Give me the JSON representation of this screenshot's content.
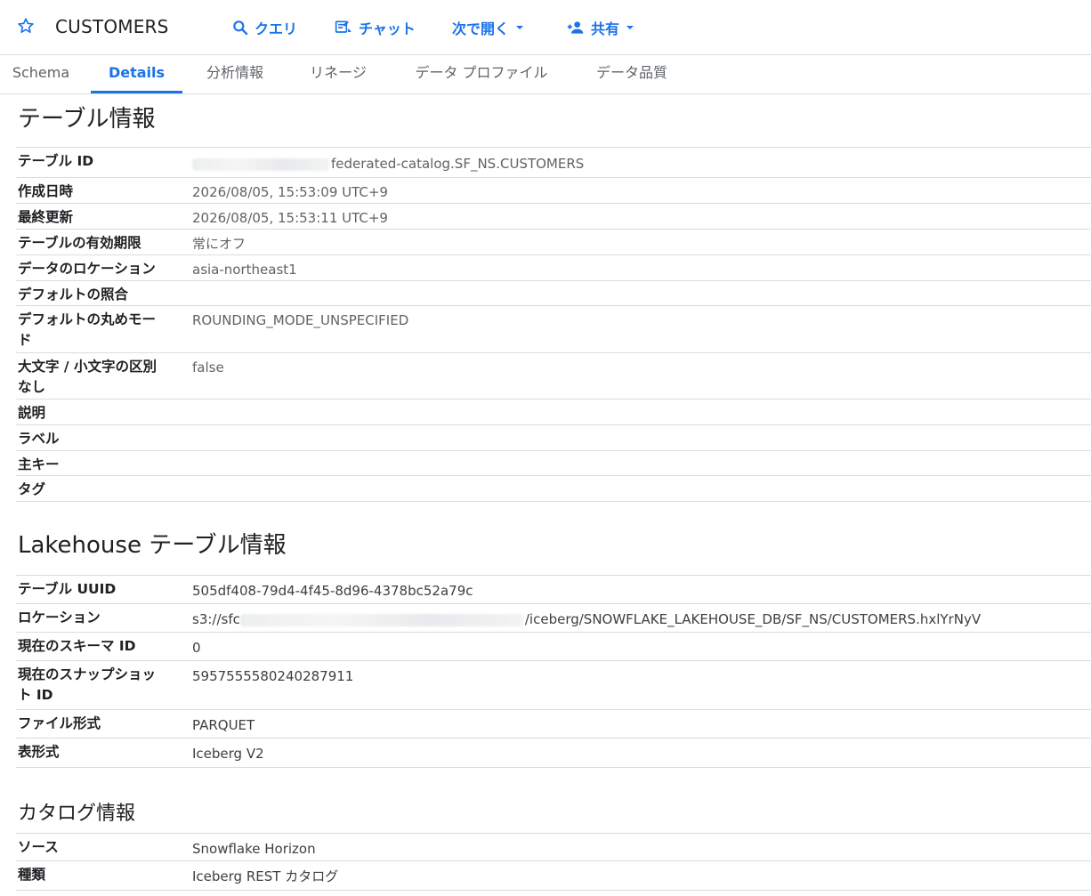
{
  "header": {
    "title": "CUSTOMERS",
    "buttons": {
      "query": "クエリ",
      "chat": "チャット",
      "open_with": "次で開く",
      "share": "共有"
    }
  },
  "tabs": [
    {
      "label": "Schema"
    },
    {
      "label": "Details"
    },
    {
      "label": "分析情報"
    },
    {
      "label": "リネージ"
    },
    {
      "label": "データ プロファイル"
    },
    {
      "label": "データ品質"
    }
  ],
  "active_tab": "Details",
  "table_info": {
    "title": "テーブル情報",
    "rows": [
      {
        "key": "テーブル ID",
        "value": "federated-catalog.SF_NS.CUSTOMERS"
      },
      {
        "key": "作成日時",
        "value": "2026/08/05, 15:53:09 UTC+9"
      },
      {
        "key": "最終更新",
        "value": "2026/08/05, 15:53:11 UTC+9"
      },
      {
        "key": "テーブルの有効期限",
        "value": "常にオフ"
      },
      {
        "key": "データのロケーション",
        "value": "asia-northeast1"
      },
      {
        "key": "デフォルトの照合",
        "value": ""
      },
      {
        "key": "デフォルトの丸めモード",
        "value": "ROUNDING_MODE_UNSPECIFIED"
      },
      {
        "key": "大文字 / 小文字の区別なし",
        "value": "false"
      },
      {
        "key": "説明",
        "value": ""
      },
      {
        "key": "ラベル",
        "value": ""
      },
      {
        "key": "主キー",
        "value": ""
      },
      {
        "key": "タグ",
        "value": ""
      }
    ]
  },
  "lakehouse_info": {
    "title": "Lakehouse テーブル情報",
    "rows": [
      {
        "key": "テーブル UUID",
        "value": "505df408-79d4-4f45-8d96-4378bc52a79c"
      },
      {
        "key": "ロケーション",
        "value_prefix": "s3://sfc",
        "value": "/iceberg/SNOWFLAKE_LAKEHOUSE_DB/SF_NS/CUSTOMERS.hxlYrNyV"
      },
      {
        "key": "現在のスキーマ ID",
        "value": "0"
      },
      {
        "key": "現在のスナップショット ID",
        "value": "5957555580240287911"
      },
      {
        "key": "ファイル形式",
        "value": "PARQUET"
      },
      {
        "key": "表形式",
        "value": "Iceberg V2"
      }
    ]
  },
  "catalog_info": {
    "title": "カタログ情報",
    "rows": [
      {
        "key": "ソース",
        "value": "Snowflake Horizon"
      },
      {
        "key": "種類",
        "value": "Iceberg REST カタログ"
      }
    ]
  },
  "colors": {
    "accent": "#1a73e8",
    "text_primary": "#202124",
    "text_secondary": "#5f6368",
    "divider": "#dadce0"
  }
}
